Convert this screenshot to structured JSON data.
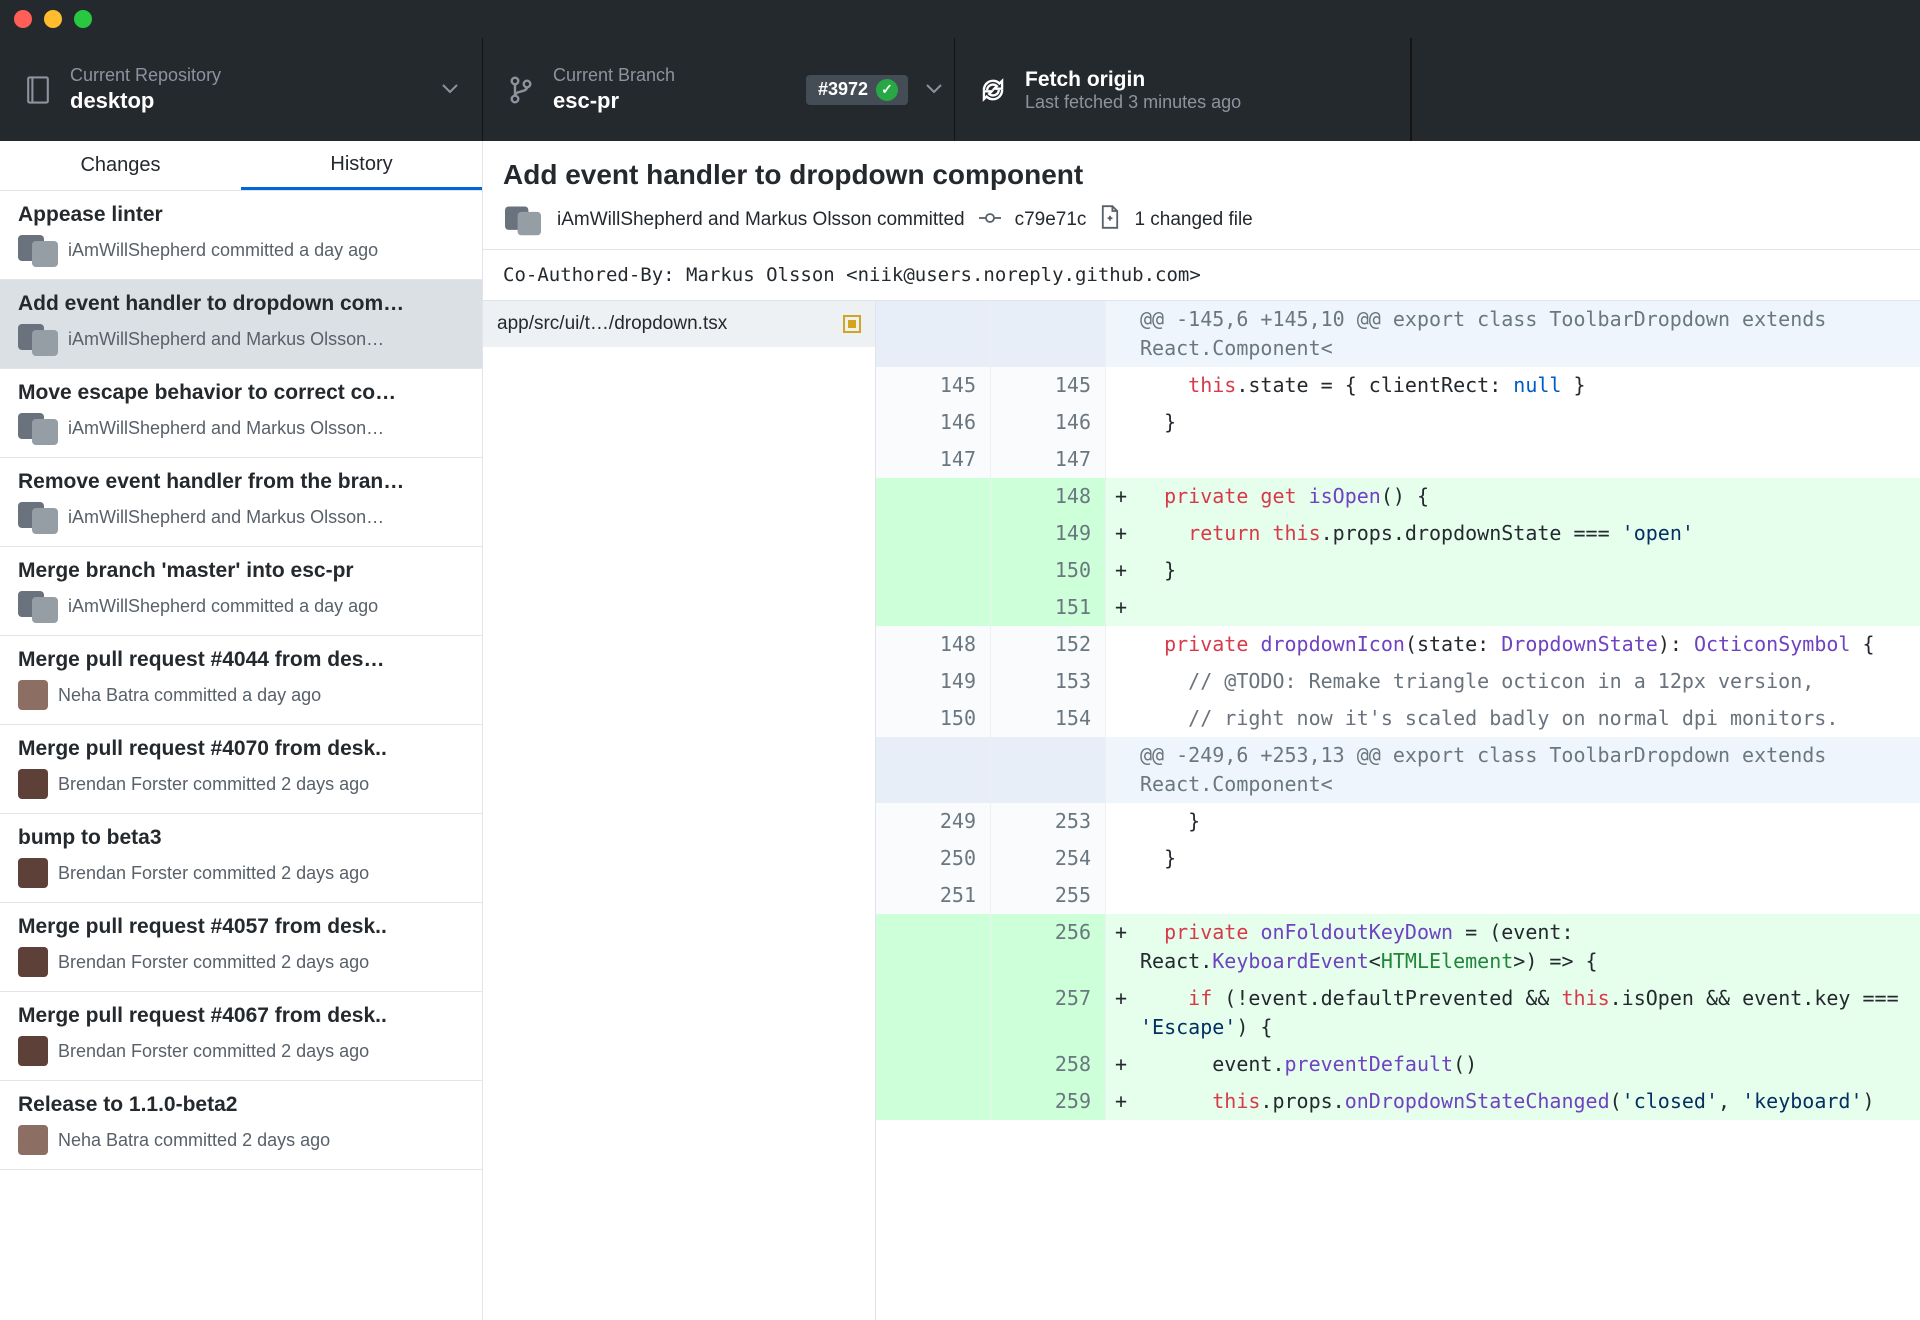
{
  "toolbar": {
    "repo": {
      "label": "Current Repository",
      "value": "desktop"
    },
    "branch": {
      "label": "Current Branch",
      "value": "esc-pr",
      "pr": "#3972"
    },
    "fetch": {
      "label": "Fetch origin",
      "sub": "Last fetched 3 minutes ago"
    }
  },
  "tabs": {
    "changes": "Changes",
    "history": "History"
  },
  "commits": [
    {
      "title": "Appease linter",
      "who": "iAmWillShepherd committed a day ago",
      "avatar": "double"
    },
    {
      "title": "Add event handler to dropdown com…",
      "who": "iAmWillShepherd and Markus Olsson…",
      "avatar": "double",
      "selected": true
    },
    {
      "title": "Move escape behavior to correct co…",
      "who": "iAmWillShepherd and Markus Olsson…",
      "avatar": "double"
    },
    {
      "title": "Remove event handler from the bran…",
      "who": "iAmWillShepherd and Markus Olsson…",
      "avatar": "double"
    },
    {
      "title": "Merge branch 'master' into esc-pr",
      "who": "iAmWillShepherd committed a day ago",
      "avatar": "double"
    },
    {
      "title": "Merge pull request #4044 from des…",
      "who": "Neha Batra committed a day ago",
      "avatar": "f1"
    },
    {
      "title": "Merge pull request #4070 from desk..",
      "who": "Brendan Forster committed 2 days ago",
      "avatar": "f2"
    },
    {
      "title": "bump to beta3",
      "who": "Brendan Forster committed 2 days ago",
      "avatar": "f2"
    },
    {
      "title": "Merge pull request #4057 from desk..",
      "who": "Brendan Forster committed 2 days ago",
      "avatar": "f2"
    },
    {
      "title": "Merge pull request #4067 from desk..",
      "who": "Brendan Forster committed 2 days ago",
      "avatar": "f2"
    },
    {
      "title": "Release to 1.1.0-beta2",
      "who": "Neha Batra committed 2 days ago",
      "avatar": "f1"
    }
  ],
  "commitHeader": {
    "title": "Add event handler to dropdown component",
    "authors": "iAmWillShepherd and Markus Olsson committed",
    "sha": "c79e71c",
    "changed": "1 changed file"
  },
  "coauthor": "Co-Authored-By: Markus Olsson <niik@users.noreply.github.com>",
  "file": {
    "path": "app/src/ui/t…/dropdown.tsx"
  },
  "diff": [
    {
      "t": "hunk",
      "old": "",
      "new": "",
      "html": "@@ -145,6 +145,10 @@ export class ToolbarDropdown extends React.Component<"
    },
    {
      "t": "ctx",
      "old": "145",
      "new": "145",
      "html": "    <span class='kw-red'>this</span>.state = { clientRect: <span class='kw-blue'>null</span> }"
    },
    {
      "t": "ctx",
      "old": "146",
      "new": "146",
      "html": "  }"
    },
    {
      "t": "ctx",
      "old": "147",
      "new": "147",
      "html": ""
    },
    {
      "t": "add",
      "old": "",
      "new": "148",
      "html": "  <span class='kw-red'>private get</span> <span class='kw-purple'>isOpen</span>() {"
    },
    {
      "t": "add",
      "old": "",
      "new": "149",
      "html": "    <span class='kw-red'>return this</span>.props.dropdownState === <span class='kw-navy'>'open'</span>"
    },
    {
      "t": "add",
      "old": "",
      "new": "150",
      "html": "  }"
    },
    {
      "t": "add",
      "old": "",
      "new": "151",
      "html": ""
    },
    {
      "t": "ctx",
      "old": "148",
      "new": "152",
      "html": "  <span class='kw-red'>private</span> <span class='kw-purple'>dropdownIcon</span>(state: <span class='kw-purple'>DropdownState</span>): <span class='kw-purple'>OcticonSymbol</span> {"
    },
    {
      "t": "ctx",
      "old": "149",
      "new": "153",
      "html": "    <span class='kw-gray'>// @TODO: Remake triangle octicon in a 12px version,</span>"
    },
    {
      "t": "ctx",
      "old": "150",
      "new": "154",
      "html": "    <span class='kw-gray'>// right now it's scaled badly on normal dpi monitors.</span>"
    },
    {
      "t": "hunk",
      "old": "",
      "new": "",
      "html": "@@ -249,6 +253,13 @@ export class ToolbarDropdown extends React.Component<"
    },
    {
      "t": "ctx",
      "old": "249",
      "new": "253",
      "html": "    }"
    },
    {
      "t": "ctx",
      "old": "250",
      "new": "254",
      "html": "  }"
    },
    {
      "t": "ctx",
      "old": "251",
      "new": "255",
      "html": ""
    },
    {
      "t": "add",
      "old": "",
      "new": "256",
      "html": "  <span class='kw-red'>private</span> <span class='kw-purple'>onFoldoutKeyDown</span> = (event: React.<span class='kw-purple'>KeyboardEvent</span>&lt;<span class='kw-green'>HTMLElement</span>&gt;) =&gt; {"
    },
    {
      "t": "add",
      "old": "",
      "new": "257",
      "html": "    <span class='kw-red'>if</span> (!event.defaultPrevented &amp;&amp; <span class='kw-red'>this</span>.isOpen &amp;&amp; event.key === <span class='kw-navy'>'Escape'</span>) {"
    },
    {
      "t": "add",
      "old": "",
      "new": "258",
      "html": "      event.<span class='kw-purple'>preventDefault</span>()"
    },
    {
      "t": "add",
      "old": "",
      "new": "259",
      "html": "      <span class='kw-red'>this</span>.props.<span class='kw-purple'>onDropdownStateChanged</span>(<span class='kw-navy'>'closed'</span>, <span class='kw-navy'>'keyboard'</span>)"
    }
  ]
}
